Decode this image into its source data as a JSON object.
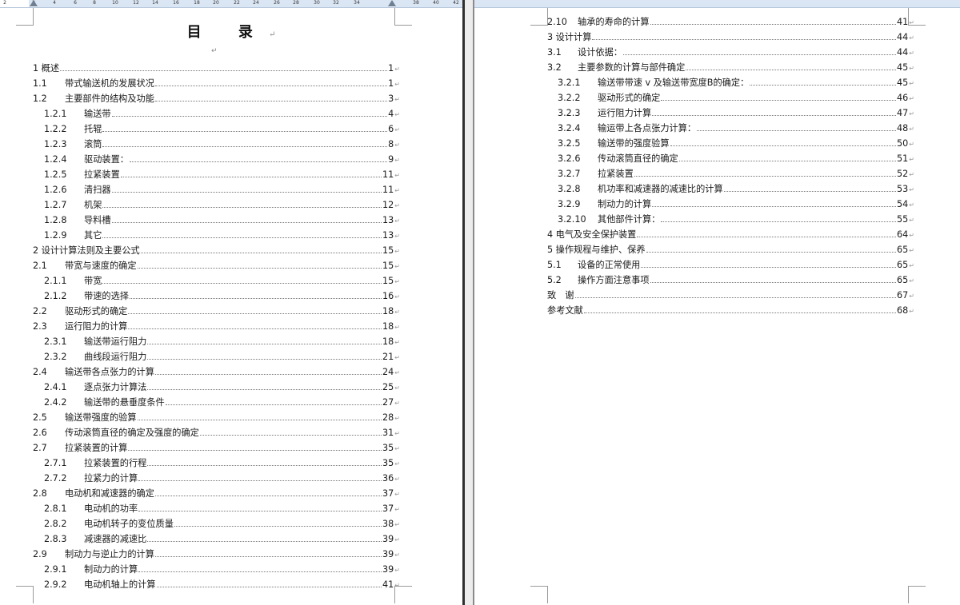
{
  "ruler": {
    "numbers": [
      "2",
      "2",
      "4",
      "6",
      "8",
      "10",
      "12",
      "14",
      "16",
      "18",
      "20",
      "22",
      "24",
      "26",
      "28",
      "30",
      "32",
      "34",
      "38",
      "40",
      "42"
    ]
  },
  "toc": {
    "title": "目 录",
    "title_mark": "↵",
    "sub_mark": "↵",
    "return_mark": "↵",
    "left_entries": [
      {
        "num": "1 概述",
        "text": "",
        "page": "1",
        "level": 0
      },
      {
        "num": "1.1",
        "text": "带式输送机的发展状况",
        "page": "1",
        "level": 1
      },
      {
        "num": "1.2",
        "text": "主要部件的结构及功能",
        "page": "3",
        "level": 1
      },
      {
        "num": "1.2.1",
        "text": "输送带",
        "page": "4",
        "level": 2
      },
      {
        "num": "1.2.2",
        "text": "托辊",
        "page": "6",
        "level": 2
      },
      {
        "num": "1.2.3",
        "text": "滚筒",
        "page": "8",
        "level": 2
      },
      {
        "num": "1.2.4",
        "text": "驱动装置：",
        "page": "9",
        "level": 2
      },
      {
        "num": "1.2.5",
        "text": "拉紧装置",
        "page": "11",
        "level": 2
      },
      {
        "num": "1.2.6",
        "text": "清扫器",
        "page": "11",
        "level": 2
      },
      {
        "num": "1.2.7",
        "text": "机架",
        "page": "12",
        "level": 2
      },
      {
        "num": "1.2.8",
        "text": "导料槽",
        "page": "13",
        "level": 2
      },
      {
        "num": "1.2.9",
        "text": "其它",
        "page": "13",
        "level": 2
      },
      {
        "num": "2 设计计算法则及主要公式",
        "text": "",
        "page": "15",
        "level": 0
      },
      {
        "num": "2.1",
        "text": "带宽与速度的确定",
        "page": "15",
        "level": 1
      },
      {
        "num": "2.1.1",
        "text": "带宽",
        "page": "15",
        "level": 2
      },
      {
        "num": "2.1.2",
        "text": "带速的选择",
        "page": "16",
        "level": 2
      },
      {
        "num": "2.2",
        "text": "驱动形式的确定",
        "page": "18",
        "level": 1
      },
      {
        "num": "2.3",
        "text": "运行阻力的计算",
        "page": "18",
        "level": 1
      },
      {
        "num": "2.3.1",
        "text": "输送带运行阻力",
        "page": "18",
        "level": 2
      },
      {
        "num": "2.3.2",
        "text": "曲线段运行阻力",
        "page": "21",
        "level": 2
      },
      {
        "num": "2.4",
        "text": "输送带各点张力的计算",
        "page": "24",
        "level": 1
      },
      {
        "num": "2.4.1",
        "text": "逐点张力计算法",
        "page": "25",
        "level": 2
      },
      {
        "num": "2.4.2",
        "text": "输送带的悬垂度条件",
        "page": "27",
        "level": 2
      },
      {
        "num": "2.5",
        "text": "输送带强度的验算",
        "page": "28",
        "level": 1
      },
      {
        "num": "2.6",
        "text": "传动滚筒直径的确定及强度的确定",
        "page": "31",
        "level": 1
      },
      {
        "num": "2.7",
        "text": "拉紧装置的计算",
        "page": "35",
        "level": 1
      },
      {
        "num": "2.7.1",
        "text": "拉紧装置的行程",
        "page": "35",
        "level": 2
      },
      {
        "num": "2.7.2",
        "text": "拉紧力的计算",
        "page": "36",
        "level": 2
      },
      {
        "num": "2.8",
        "text": "电动机和减速器的确定",
        "page": "37",
        "level": 1
      },
      {
        "num": "2.8.1",
        "text": "电动机的功率",
        "page": "37",
        "level": 2
      },
      {
        "num": "2.8.2",
        "text": "电动机转子的变位质量",
        "page": "38",
        "level": 2
      },
      {
        "num": "2.8.3",
        "text": "减速器的减速比",
        "page": "39",
        "level": 2
      },
      {
        "num": "2.9",
        "text": "制动力与逆止力的计算",
        "page": "39",
        "level": 1
      },
      {
        "num": "2.9.1",
        "text": "制动力的计算",
        "page": "39",
        "level": 2
      },
      {
        "num": "2.9.2",
        "text": "电动机轴上的计算",
        "page": "41",
        "level": 2
      }
    ],
    "right_entries": [
      {
        "num": "2.10",
        "text": "轴承的寿命的计算",
        "page": "41",
        "level": 1
      },
      {
        "num": "3 设计计算",
        "text": "",
        "page": "44",
        "level": 0
      },
      {
        "num": "3.1",
        "text": "设计依据：",
        "page": "44",
        "level": 1
      },
      {
        "num": "3.2",
        "text": "主要参数的计算与部件确定",
        "page": "45",
        "level": 1
      },
      {
        "num": "3.2.1",
        "text": "输送带带速 v 及输送带宽度B的确定：",
        "page": "45",
        "level": 2
      },
      {
        "num": "3.2.2",
        "text": "驱动形式的确定",
        "page": "46",
        "level": 2
      },
      {
        "num": "3.2.3",
        "text": "运行阻力计算",
        "page": "47",
        "level": 2
      },
      {
        "num": "3.2.4",
        "text": "输运带上各点张力计算：",
        "page": "48",
        "level": 2
      },
      {
        "num": "3.2.5",
        "text": "输送带的强度验算",
        "page": "50",
        "level": 2
      },
      {
        "num": "3.2.6",
        "text": "传动滚筒直径的确定",
        "page": "51",
        "level": 2
      },
      {
        "num": "3.2.7",
        "text": "拉紧装置",
        "page": "52",
        "level": 2
      },
      {
        "num": "3.2.8",
        "text": "机功率和减速器的减速比的计算",
        "page": "53",
        "level": 2
      },
      {
        "num": "3.2.9",
        "text": "制动力的计算",
        "page": "54",
        "level": 2
      },
      {
        "num": "3.2.10",
        "text": "其他部件计算：",
        "page": "55",
        "level": 2
      },
      {
        "num": "4 电气及安全保护装置",
        "text": "",
        "page": "64",
        "level": 0
      },
      {
        "num": "5 操作规程与维护、保养",
        "text": "",
        "page": "65",
        "level": 0
      },
      {
        "num": "5.1",
        "text": "设备的正常使用",
        "page": "65",
        "level": 1
      },
      {
        "num": "5.2",
        "text": "操作方面注意事项",
        "page": "65",
        "level": 1
      },
      {
        "num": "致　谢",
        "text": "",
        "page": "67",
        "level": 0
      },
      {
        "num": "参考文献",
        "text": "",
        "page": "68",
        "level": 0
      }
    ]
  }
}
